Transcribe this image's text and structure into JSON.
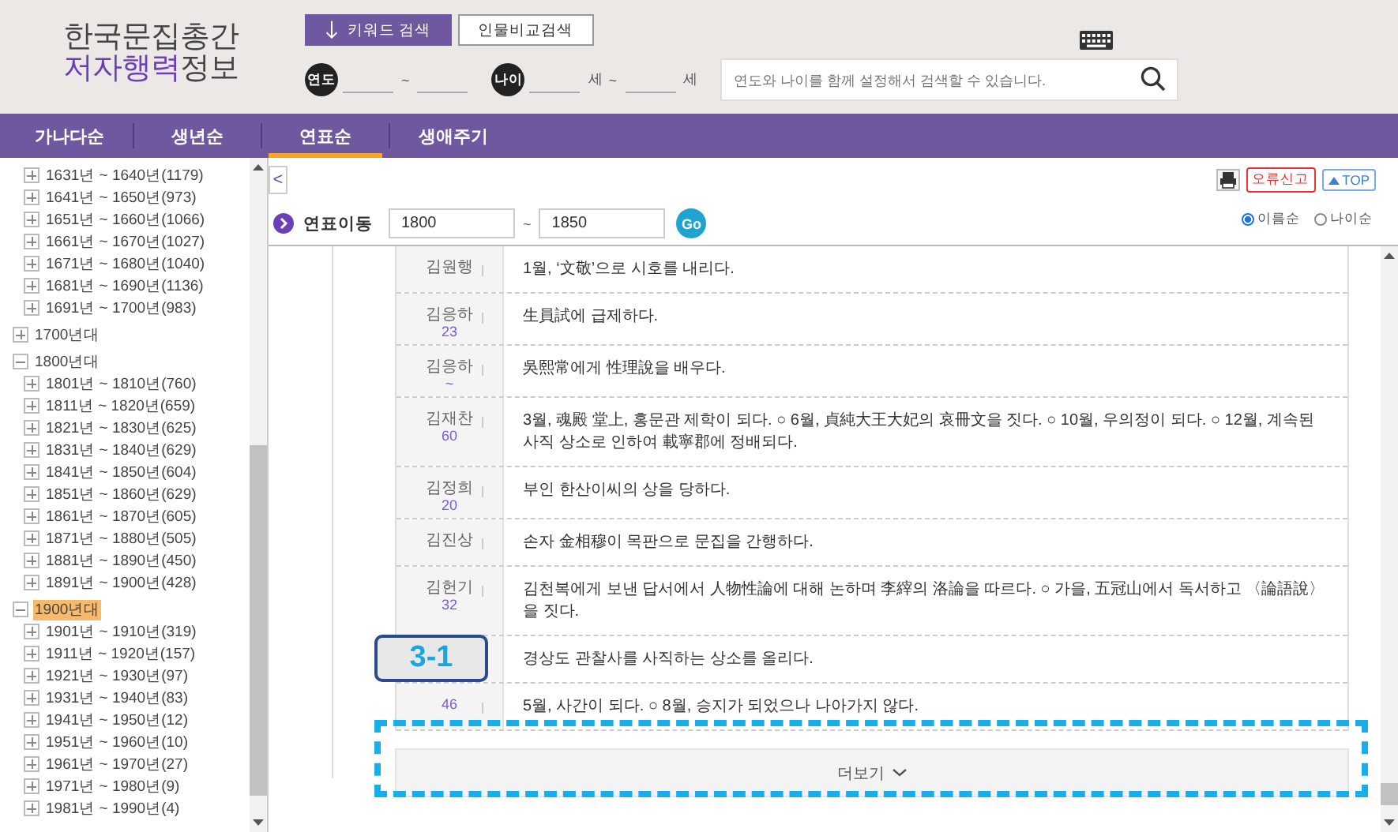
{
  "header": {
    "logo_line1": "한국문집총간",
    "logo_line2_accent": "저자행력",
    "logo_line2_rest": "정보",
    "search_tabs": [
      {
        "label": "키워드 검색",
        "selected": true
      },
      {
        "label": "인물비교검색",
        "selected": false
      }
    ],
    "year_badge": "연도",
    "year_separator": "~",
    "age_badge": "나이",
    "age_unit_from": "세",
    "age_separator": "~",
    "age_unit_to": "세",
    "search": {
      "placeholder": "연도와 나이를 함께 설정해서 검색할 수 있습니다."
    }
  },
  "nav": [
    {
      "label": "가나다순",
      "selected": false
    },
    {
      "label": "생년순",
      "selected": false
    },
    {
      "label": "연표순",
      "selected": true
    },
    {
      "label": "생애주기",
      "selected": false
    }
  ],
  "sidebar": {
    "items": [
      {
        "children": [
          {
            "label": "1631년 ~ 1640년(1179)"
          },
          {
            "label": "1641년 ~ 1650년(973)"
          },
          {
            "label": "1651년 ~ 1660년(1066)"
          },
          {
            "label": "1661년 ~ 1670년(1027)"
          },
          {
            "label": "1671년 ~ 1680년(1040)"
          },
          {
            "label": "1681년 ~ 1690년(1136)"
          },
          {
            "label": "1691년 ~ 1700년(983)"
          }
        ]
      },
      {
        "label": "1700년대",
        "expanded": false,
        "selected": false
      },
      {
        "label": "1800년대",
        "expanded": true,
        "selected": false,
        "children": [
          {
            "label": "1801년 ~ 1810년(760)"
          },
          {
            "label": "1811년 ~ 1820년(659)"
          },
          {
            "label": "1821년 ~ 1830년(625)"
          },
          {
            "label": "1831년 ~ 1840년(629)"
          },
          {
            "label": "1841년 ~ 1850년(604)"
          },
          {
            "label": "1851년 ~ 1860년(629)"
          },
          {
            "label": "1861년 ~ 1870년(605)"
          },
          {
            "label": "1871년 ~ 1880년(505)"
          },
          {
            "label": "1881년 ~ 1890년(450)"
          },
          {
            "label": "1891년 ~ 1900년(428)"
          }
        ]
      },
      {
        "label": "1900년대",
        "expanded": true,
        "selected": true,
        "children": [
          {
            "label": "1901년 ~ 1910년(319)"
          },
          {
            "label": "1911년 ~ 1920년(157)"
          },
          {
            "label": "1921년 ~ 1930년(97)"
          },
          {
            "label": "1931년 ~ 1940년(83)"
          },
          {
            "label": "1941년 ~ 1950년(12)"
          },
          {
            "label": "1951년 ~ 1960년(10)"
          },
          {
            "label": "1961년 ~ 1970년(27)"
          },
          {
            "label": "1971년 ~ 1980년(9)"
          },
          {
            "label": "1981년 ~ 1990년(4)"
          }
        ]
      }
    ]
  },
  "toolbar": {
    "back": "<",
    "report_button": "오류신고",
    "top_button": "TOP"
  },
  "timeline_nav": {
    "label": "연표이동",
    "from": "1800",
    "separator": "~",
    "to": "1850",
    "go": "Go",
    "sort": [
      {
        "label": "이름순",
        "selected": true
      },
      {
        "label": "나이순",
        "selected": false
      }
    ]
  },
  "rows": [
    {
      "name": "김원행",
      "text": "1월, ‘文敬’으로 시호를 내리다."
    },
    {
      "name": "김응하",
      "age": "23",
      "text": "生員試에 급제하다."
    },
    {
      "name": "김응하",
      "age": "~",
      "text": "吳熙常에게 性理說을 배우다."
    },
    {
      "name": "김재찬",
      "age": "60",
      "text": "3월, 魂殿 堂上, 홍문관 제학이 되다. ○ 6월, 貞純大王大妃의 哀冊文을 짓다. ○ 10월, 우의정이 되다. ○ 12월, 계속된 사직 상소로 인하여 載寧郡에 정배되다."
    },
    {
      "name": "김정희",
      "age": "20",
      "text": "부인 한산이씨의 상을 당하다."
    },
    {
      "name": "김진상",
      "text": "손자 金相穆이 목판으로 문집을 간행하다."
    },
    {
      "name": "김헌기",
      "age": "32",
      "text": "김천복에게 보낸 답서에서 人物性論에 대해 논하며 李縡의 洛論을 따르다. ○ 가을, 五冠山에서 독서하고 〈論語說〉을 짓다."
    },
    {
      "text": "경상도 관찰사를 사직하는 상소를 올리다."
    },
    {
      "age": "46",
      "text": "5월, 사간이 되다. ○ 8월, 승지가 되었으나 나아가지 않다."
    }
  ],
  "more_button": "더보기",
  "annotation": {
    "label": "3-1"
  }
}
